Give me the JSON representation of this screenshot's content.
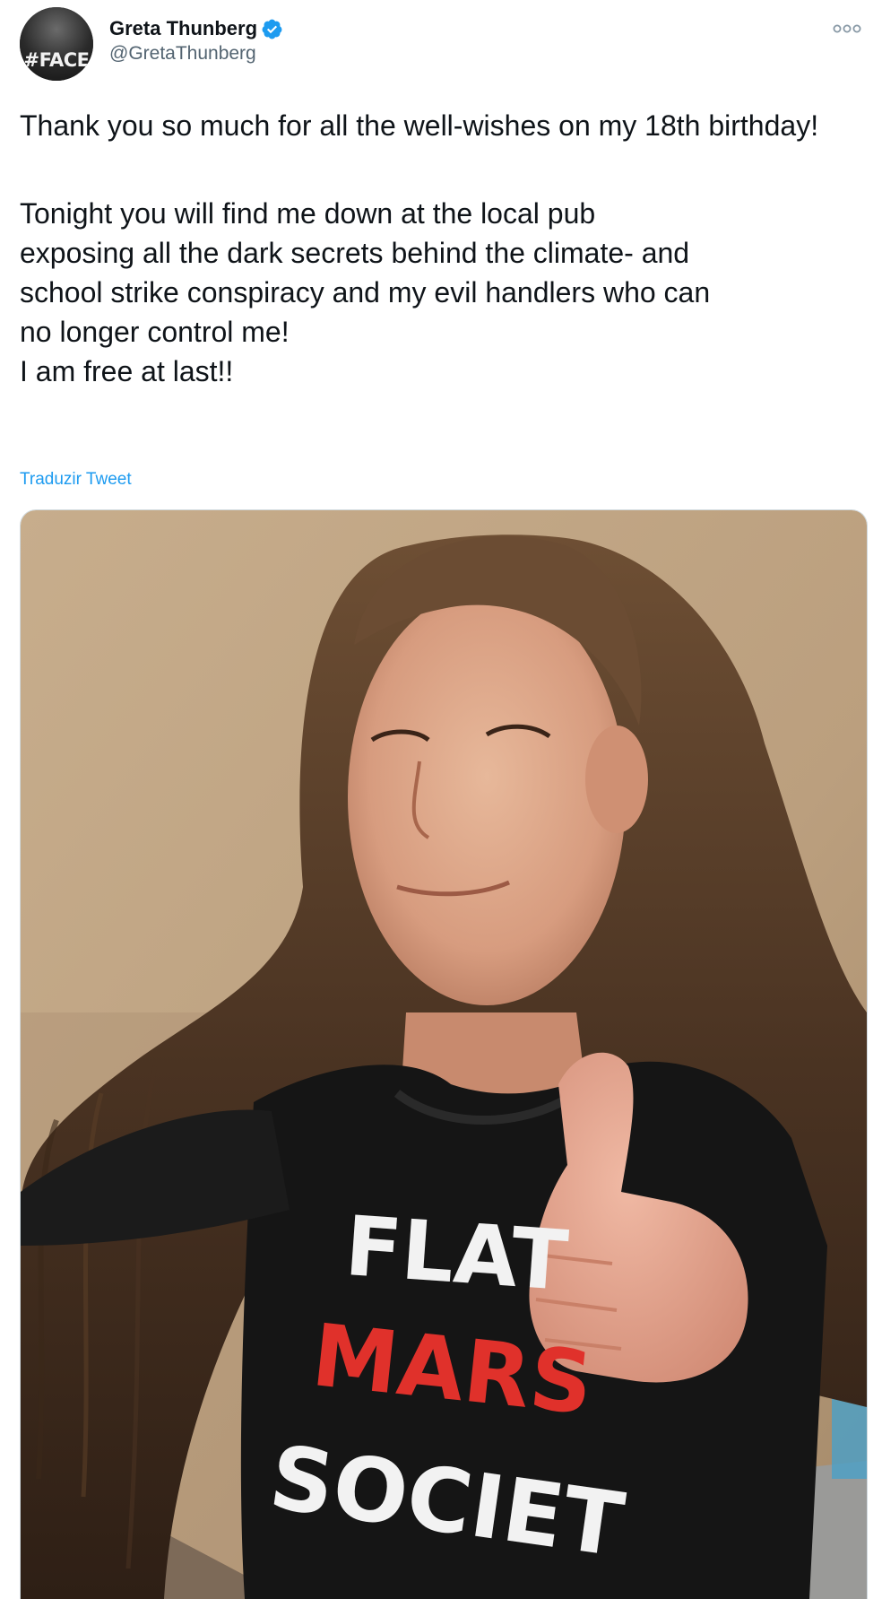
{
  "author": {
    "display_name": "Greta Thunberg",
    "handle": "@GretaThunberg",
    "avatar_text": "#FACE",
    "verified": true
  },
  "tweet": {
    "paragraph_1": "Thank you so much for all the well-wishes on my 18th birthday!",
    "paragraph_2_lines": [
      "Tonight you will find me down at the local pub",
      "exposing all the dark secrets behind the climate- and",
      "school strike conspiracy and my evil handlers who can",
      "no longer control me!",
      "I am free at last!!"
    ],
    "translate_label": "Traduzir Tweet"
  },
  "media": {
    "shirt_lines": [
      "FLAT",
      "MARS",
      "SOCIET"
    ]
  },
  "colors": {
    "link": "#1d9bf0",
    "verified": "#1d9bf0",
    "text": "#0f1419",
    "secondary": "#536471"
  }
}
